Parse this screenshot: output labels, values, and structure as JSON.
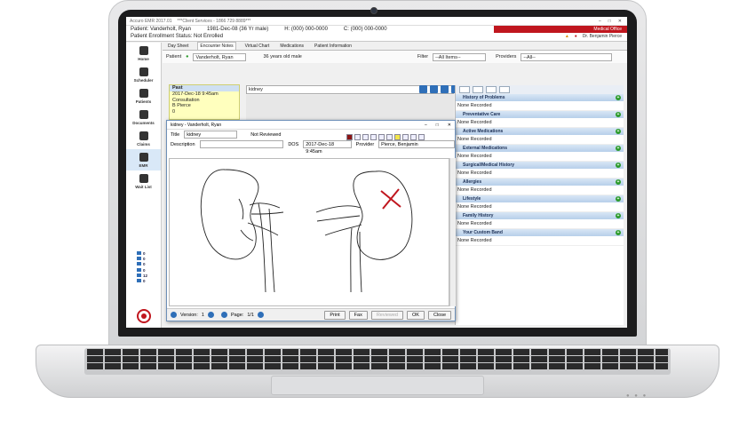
{
  "app": {
    "title": "Accuro EMR 2017.01",
    "subtitle": "***Client Services - 1866 729 8889***"
  },
  "patient": {
    "line1_name": "Patient: Vanderholt, Ryan",
    "line1_dob": "1981-Dec-08 (36 Yr male)",
    "line1_home": "H: (000) 000-0000",
    "line1_cell": "C: (000) 000-0000",
    "line2": "Patient Enrollment Status: Not Enrolled"
  },
  "office": {
    "label": "Medical Office",
    "physician": "Dr. Benjamin Pierce"
  },
  "nav": [
    {
      "label": "Home"
    },
    {
      "label": "Scheduler"
    },
    {
      "label": "Patients"
    },
    {
      "label": "Documents"
    },
    {
      "label": "Claims"
    },
    {
      "label": "EMR"
    },
    {
      "label": "Wait List"
    }
  ],
  "nav_counts": [
    "0",
    "0",
    "0",
    "0",
    "12",
    "0"
  ],
  "tabs": [
    "Day Sheet",
    "Encounter Notes",
    "Virtual Chart",
    "Medications",
    "Patient Information"
  ],
  "selector": {
    "patient_label": "Patient",
    "patient_value": "Vanderholt, Ryan",
    "age": "36 years old male",
    "filter_label": "Filter",
    "filter_value": "--All Items--",
    "providers_label": "Providers",
    "providers_value": "--All--"
  },
  "past": {
    "header": "Past",
    "date": "2017-Dec-18 9:45am",
    "type": "Consultation",
    "provider": "B Pierce",
    "count": "0"
  },
  "kidney_search": "kidney",
  "right_panel": {
    "bands": [
      {
        "title": "History of Problems",
        "value": "None Recorded"
      },
      {
        "title": "Preventative Care",
        "value": "None Recorded"
      },
      {
        "title": "Active Medications",
        "value": "None Recorded"
      },
      {
        "title": "External Medications",
        "value": "None Recorded"
      },
      {
        "title": "Surgical/Medical History",
        "value": "None Recorded"
      },
      {
        "title": "Allergies",
        "value": "None Recorded"
      },
      {
        "title": "Lifestyle",
        "value": "None Recorded"
      },
      {
        "title": "Family History",
        "value": "None Recorded"
      },
      {
        "title": "Your Custom Band",
        "value": "None Recorded"
      }
    ]
  },
  "dialog": {
    "title": "kidney - Vanderholt, Ryan",
    "title_label": "Title",
    "title_value": "kidney",
    "status": "Not Reviewed",
    "description_label": "Description",
    "dos_label": "DOS",
    "dos_value": "2017-Dec-18 9:45am",
    "provider_label": "Provider",
    "provider_value": "Pierce, Benjamin",
    "version_label": "Version:",
    "version_value": "1",
    "page_label": "Page:",
    "page_value": "1/1",
    "buttons": {
      "print": "Print",
      "fax": "Fax",
      "reviewed": "Reviewed",
      "ok": "OK",
      "close": "Close"
    }
  }
}
